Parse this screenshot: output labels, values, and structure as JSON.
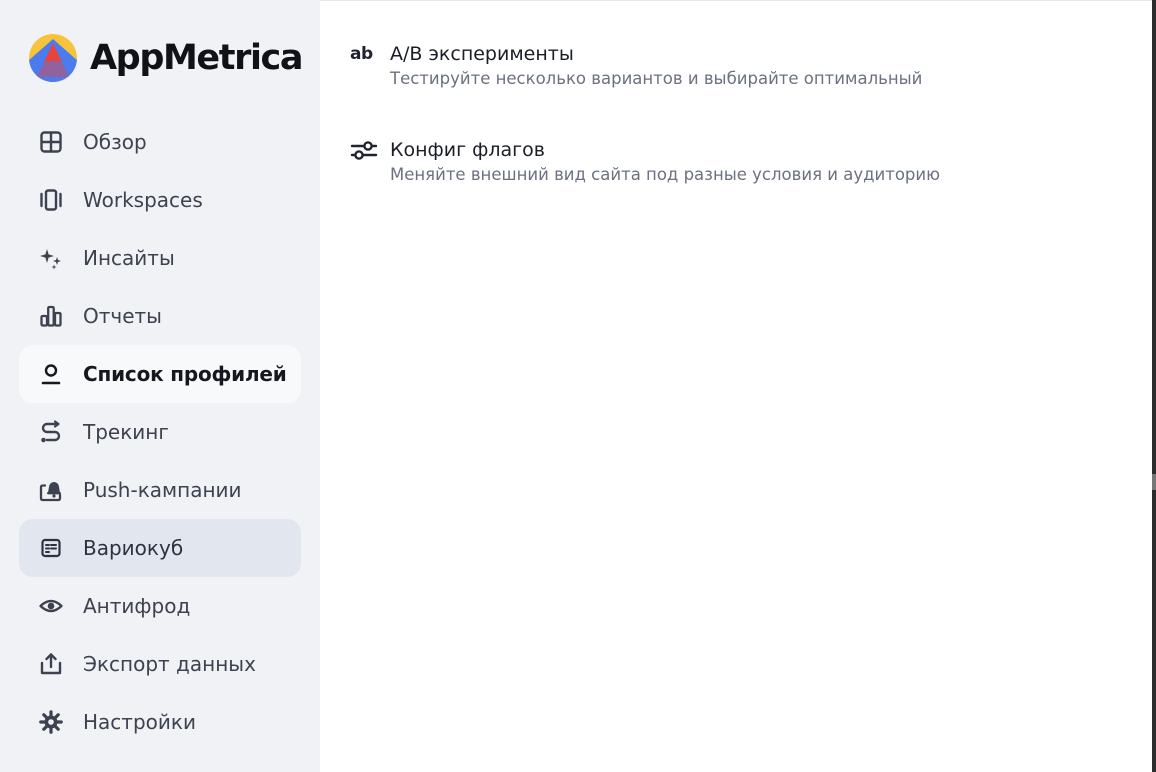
{
  "app": {
    "name": "AppMetrica",
    "logo_icon": "appmetrica-logo-icon",
    "colors": {
      "logo_red": "#e8433c",
      "logo_yellow": "#f7c33b",
      "logo_blue": "#4a7cf0",
      "sidebar_bg": "#f1f2f6",
      "active_item_bg": "#e2e6ee"
    }
  },
  "sidebar": {
    "items": [
      {
        "id": "overview",
        "label": "Обзор",
        "icon": "grid-icon"
      },
      {
        "id": "workspaces",
        "label": "Workspaces",
        "icon": "carousel-icon"
      },
      {
        "id": "insights",
        "label": "Инсайты",
        "icon": "sparkles-icon"
      },
      {
        "id": "reports",
        "label": "Отчеты",
        "icon": "bar-chart-icon"
      },
      {
        "id": "profiles",
        "label": "Список профилей",
        "icon": "user-icon",
        "state": "hovered"
      },
      {
        "id": "tracking",
        "label": "Трекинг",
        "icon": "route-icon"
      },
      {
        "id": "push",
        "label": "Push-кампании",
        "icon": "bell-icon"
      },
      {
        "id": "varioqub",
        "label": "Вариокуб",
        "icon": "varioqub-icon",
        "state": "selected"
      },
      {
        "id": "antifraud",
        "label": "Антифрод",
        "icon": "eye-icon"
      },
      {
        "id": "export",
        "label": "Экспорт данных",
        "icon": "export-icon"
      },
      {
        "id": "settings",
        "label": "Настройки",
        "icon": "gear-icon"
      }
    ]
  },
  "menu": {
    "entries": [
      {
        "id": "ab-experiments",
        "icon": "ab-icon",
        "icon_text": "ab",
        "title": "A/B эксперименты",
        "description": "Тестируйте несколько вариантов и выбирайте оптимальный"
      },
      {
        "id": "flags-config",
        "icon": "sliders-icon",
        "title": "Конфиг флагов",
        "description": "Меняйте внешний вид сайта под разные условия и аудиторию"
      }
    ]
  }
}
